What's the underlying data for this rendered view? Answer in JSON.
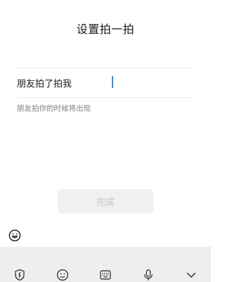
{
  "header": {
    "title": "设置拍一拍"
  },
  "pat": {
    "prefix": "朋友拍了拍我",
    "value": "",
    "hint": "朋友拍你的时候将出现"
  },
  "actions": {
    "done_label": "完成"
  },
  "emoji_bar": {
    "icon": "emoji-smile-icon"
  },
  "keyboard_toolbar": {
    "icons": [
      "shield-icon",
      "face-icon",
      "keyboard-icon",
      "microphone-icon",
      "chevron-down-icon"
    ]
  },
  "colors": {
    "caret": "#3a8ee6",
    "button_bg": "#f0f0f0",
    "button_text": "#c4c4c4",
    "hint_text": "#7f7f7f",
    "keyboard_bg": "#eeeeef"
  }
}
